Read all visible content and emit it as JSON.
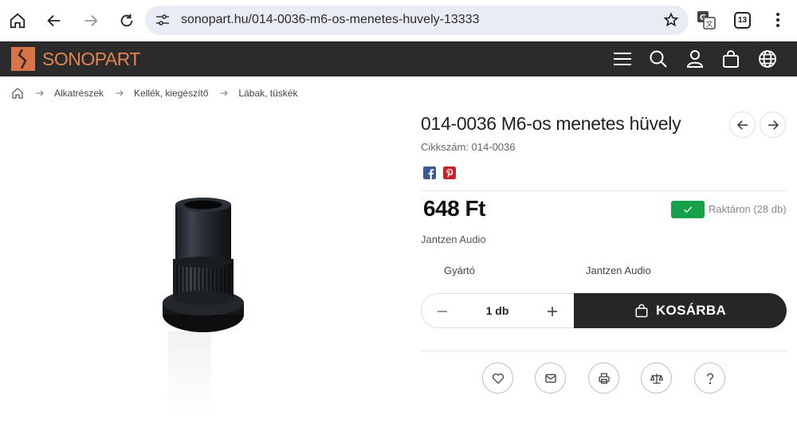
{
  "browser": {
    "url": "sonopart.hu/014-0036-m6-os-menetes-huvely-13333",
    "tab_count": "13",
    "icons": [
      "home-icon",
      "back-icon",
      "forward-icon",
      "reload-icon",
      "site-settings-icon",
      "star-icon",
      "translate-icon",
      "tabs-icon",
      "more-icon"
    ]
  },
  "site": {
    "logo_text": "SONOPART",
    "brand_color": "#e2834f",
    "header_icons": [
      "menu-icon",
      "search-icon",
      "user-icon",
      "cart-icon",
      "globe-icon"
    ]
  },
  "breadcrumb": {
    "items": [
      "Alkatrészek",
      "Kellék, kiegészítő",
      "Lábak, tüskék"
    ]
  },
  "product": {
    "title": "014-0036 M6-os menetes hüvely",
    "sku": "Cikkszám: 014-0036",
    "price": "648 Ft",
    "stock": "Raktáron (28 db)",
    "stock_color": "#17a04a",
    "brand": "Jantzen Audio",
    "spec_label": "Gyártó",
    "spec_value": "Jantzen Audio",
    "quantity": "1 db",
    "add_to_cart": "KOSÁRBA",
    "social": [
      "facebook-icon",
      "pinterest-icon"
    ],
    "actions": [
      "heart-icon",
      "mail-icon",
      "print-icon",
      "compare-icon",
      "question-icon"
    ]
  }
}
